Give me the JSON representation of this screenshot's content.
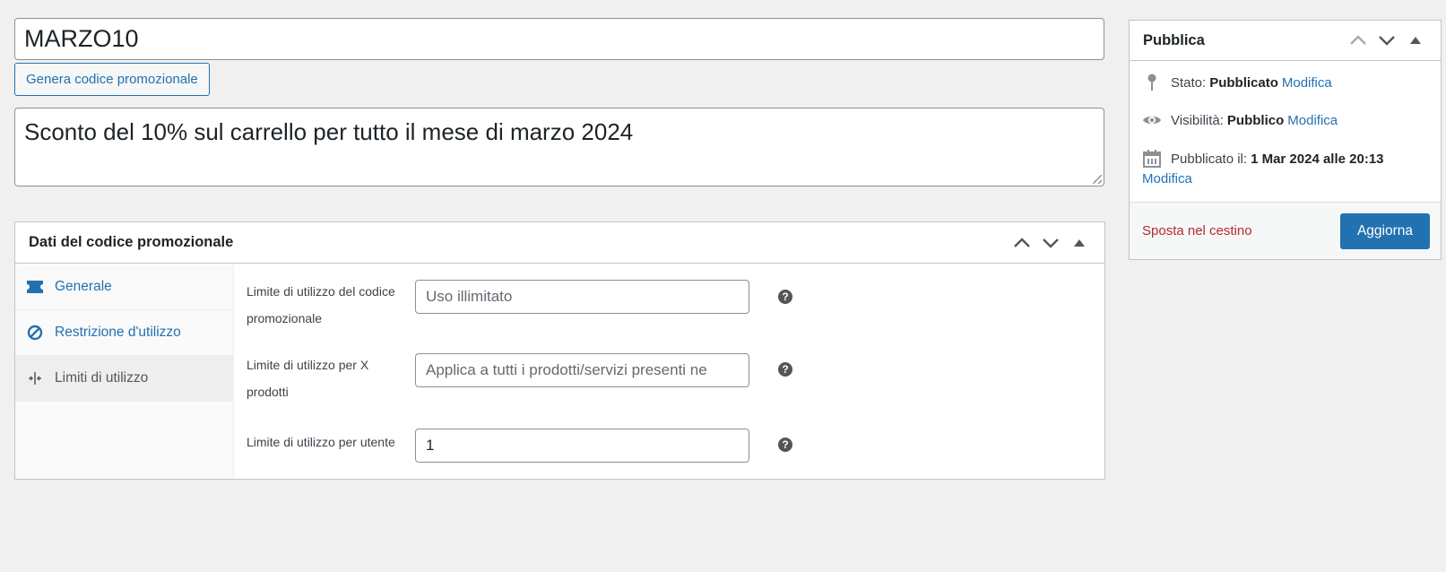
{
  "coupon": {
    "code": "MARZO10",
    "generate_label": "Genera codice promozionale",
    "description": "Sconto del 10% sul carrello per tutto il mese di marzo 2024"
  },
  "coupon_data": {
    "title": "Dati del codice promozionale",
    "tabs": [
      {
        "label": "Generale",
        "icon": "ticket-icon"
      },
      {
        "label": "Restrizione d'utilizzo",
        "icon": "block-icon"
      },
      {
        "label": "Limiti di utilizzo",
        "icon": "limits-icon"
      }
    ],
    "fields": [
      {
        "label": "Limite di utilizzo del codice promozionale",
        "value": "",
        "placeholder": "Uso illimitato"
      },
      {
        "label": "Limite di utilizzo per X prodotti",
        "value": "",
        "placeholder": "Applica a tutti i prodotti/servizi presenti ne"
      },
      {
        "label": "Limite di utilizzo per utente",
        "value": "1",
        "placeholder": ""
      }
    ],
    "help_glyph": "?"
  },
  "publish": {
    "title": "Pubblica",
    "status_label": "Stato:",
    "status_value": "Pubblicato",
    "visibility_label": "Visibilità:",
    "visibility_value": "Pubblico",
    "published_label": "Pubblicato il:",
    "published_value": "1 Mar 2024 alle 20:13",
    "edit_label": "Modifica",
    "trash_label": "Sposta nel cestino",
    "update_label": "Aggiorna"
  },
  "colors": {
    "accent": "#2271b1",
    "trash": "#b32d2e",
    "background": "#f0f0f1"
  }
}
